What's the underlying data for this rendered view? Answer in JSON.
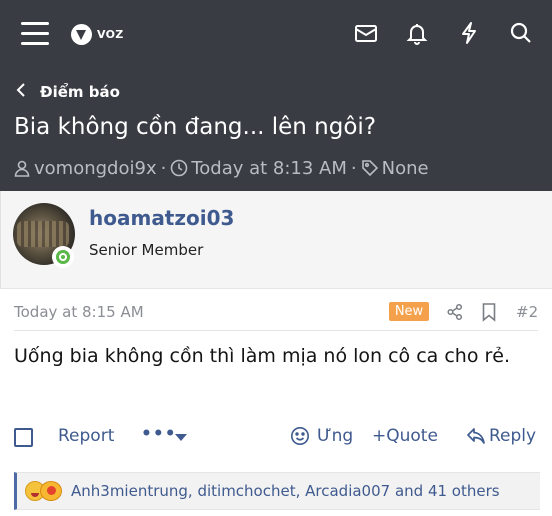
{
  "header": {
    "logo_text": "VOZ",
    "icons": [
      "menu-icon",
      "mail-icon",
      "bell-icon",
      "lightning-icon",
      "search-icon"
    ]
  },
  "breadcrumb": {
    "label": "Điểm báo"
  },
  "thread": {
    "title": "Bia không cồn đang... lên ngôi?",
    "starter": "vomongdoi9x",
    "time": "Today at 8:13 AM",
    "tags": "None"
  },
  "post": {
    "username": "hoamatzoi03",
    "user_title": "Senior Member",
    "date": "Today at 8:15 AM",
    "new_label": "New",
    "number": "#2",
    "body": "Uống bia không cồn thì làm mịa nó lon cô ca cho rẻ.",
    "actions": {
      "report": "Report",
      "more": "•••",
      "react": "Ưng",
      "quote": "+Quote",
      "reply": "Reply"
    },
    "reactions": {
      "names": "Anh3mientrung, ditimchochet, Arcadia007 and 41 others"
    }
  },
  "colors": {
    "header_bg": "#393c43",
    "link": "#3f5a8e",
    "new_badge": "#f5a04a",
    "online": "#5ab748"
  }
}
